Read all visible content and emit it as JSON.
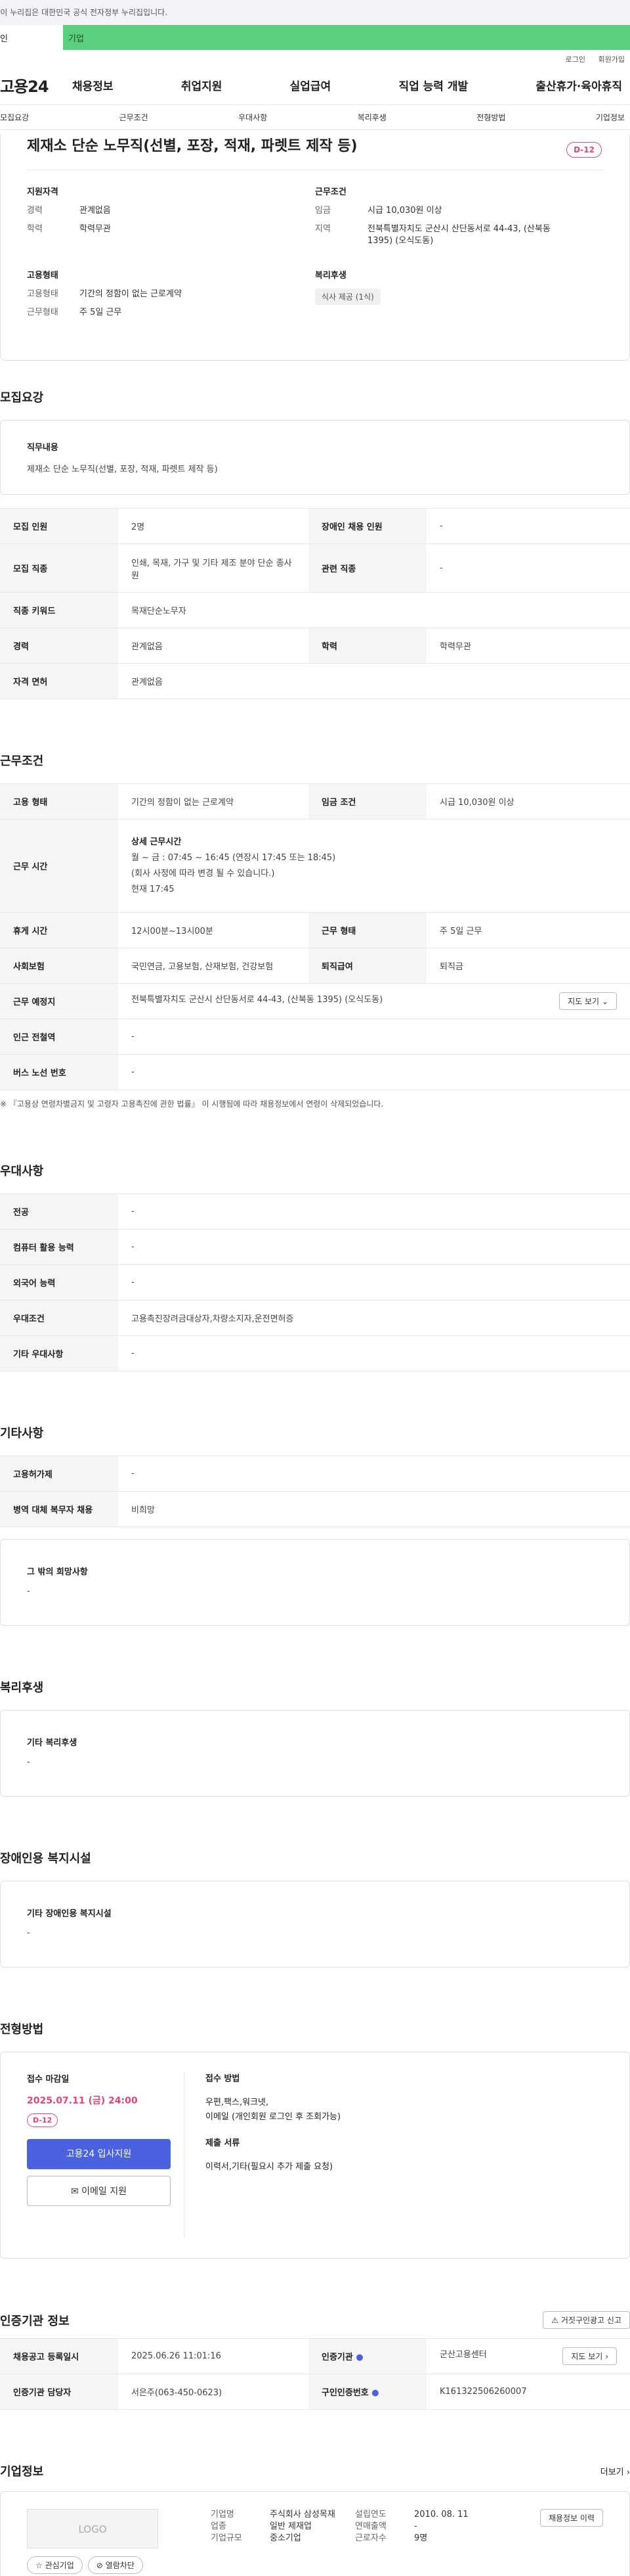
{
  "govbar": {
    "text": "○ 이 누리집은 대한민국 공식 전자정부 누리집입니다."
  },
  "top_tabs": {
    "left": "인",
    "right": "기업"
  },
  "util": {
    "login": "로그인",
    "join": "회원가입"
  },
  "gnb": {
    "logo": "고용24",
    "menu": [
      "채용정보",
      "취업지원",
      "실업급여",
      "직업 능력 개발",
      "출산휴가·육아휴직"
    ]
  },
  "subnav": [
    "모집요강",
    "근무조건",
    "우대사항",
    "복리후생",
    "전형방법",
    "기업정보"
  ],
  "header": {
    "title": "제재소 단순 노무직(선별, 포장, 적재, 파렛트 제작 등)",
    "dday": "D-12",
    "qual_title": "지원자격",
    "qual": [
      {
        "k": "경력",
        "v": "관계없음"
      },
      {
        "k": "학력",
        "v": "학력무관"
      }
    ],
    "cond_title": "근무조건",
    "cond": [
      {
        "k": "임금",
        "v": "시급 10,030원 이상"
      },
      {
        "k": "지역",
        "v": "전북특별자치도 군산시 산단동서로 44-43, (산북동 1395) (오식도동)"
      }
    ],
    "emp_title": "고용형태",
    "emp": [
      {
        "k": "고용형태",
        "v": "기간의 정함이 없는 근로계약"
      },
      {
        "k": "근무형태",
        "v": "주 5일 근무"
      }
    ],
    "welfare_title": "복리후생",
    "welfare_chip": "식사 제공 (1식)"
  },
  "recruit": {
    "title": "모집요강",
    "duty_label": "직무내용",
    "duty": "제재소 단순 노무직(선별, 포장, 적재, 파렛트 제작 등)",
    "rows": [
      {
        "k1": "모집 인원",
        "v1": "2명",
        "k2": "장애인 채용 인원",
        "v2": "-"
      },
      {
        "k1": "모집 직종",
        "v1": "인쇄, 목재, 가구 및 기타 제조 분야 단순 종사원",
        "k2": "관련 직종",
        "v2": "-"
      },
      {
        "k1": "직종 키워드",
        "v1": "목재단순노무자"
      },
      {
        "k1": "경력",
        "v1": "관계없음",
        "k2": "학력",
        "v2": "학력무관"
      },
      {
        "k1": "자격 면허",
        "v1": "관계없음"
      }
    ]
  },
  "work": {
    "title": "근무조건",
    "type_k": "고용 형태",
    "type_v": "기간의 정함이 없는 근로계약",
    "wage_k": "임금 조건",
    "wage_v": "시급 10,030원 이상",
    "hours_k": "근무 시간",
    "hours_title": "상세 근무시간",
    "hours_lines": [
      "월 ~ 금 : 07:45 ~ 16:45 (연장시 17:45 또는 18:45)",
      "(회사 사정에 따라 변경 될 수 있습니다.)",
      "현재 17:45"
    ],
    "break_k": "휴게 시간",
    "break_v": "12시00분~13시00분",
    "form_k": "근무 형태",
    "form_v": "주 5일 근무",
    "ins_k": "사회보험",
    "ins_v": "국민연금, 고용보험, 산재보험, 건강보험",
    "sev_k": "퇴직급여",
    "sev_v": "퇴직금",
    "place_k": "근무 예정지",
    "place_v": "전북특별자치도 군산시 산단동서로 44-43, (산북동 1395) (오식도동)",
    "map_btn": "지도 보기",
    "station_k": "인근 전철역",
    "station_v": "-",
    "bus_k": "버스 노선 번호",
    "bus_v": "-",
    "note": "※ 『고용상 연령차별금지 및 고령자 고용촉진에 관한 법률』 이 시행됨에 따라 채용정보에서 연령이 삭제되었습니다."
  },
  "pref": {
    "title": "우대사항",
    "rows": [
      {
        "k": "전공",
        "v": "-"
      },
      {
        "k": "컴퓨터 활용 능력",
        "v": "-"
      },
      {
        "k": "외국어 능력",
        "v": "-"
      },
      {
        "k": "우대조건",
        "v": "고용촉진장려금대상자,차량소지자,운전면허증"
      },
      {
        "k": "기타 우대사항",
        "v": "-"
      }
    ]
  },
  "etc": {
    "title": "기타사항",
    "rows": [
      {
        "k": "고용허가제",
        "v": "-"
      },
      {
        "k": "병역 대체 복무자 채용",
        "v": "비희망"
      }
    ],
    "hope_label": "그 밖의 희망사항",
    "hope_v": "-"
  },
  "welfare": {
    "title": "복리후생",
    "label": "기타 복리후생",
    "v": "-"
  },
  "disabled": {
    "title": "장애인용 복지시설",
    "label": "기타 장애인용 복지시설",
    "v": "-"
  },
  "selection": {
    "title": "전형방법",
    "deadline_label": "접수 마감일",
    "deadline": "2025.07.11 (금) 24:00",
    "dday": "D-12",
    "apply_btn": "고용24 입사지원",
    "email_btn": "이메일 지원",
    "method_label": "접수 방법",
    "method_lines": [
      "우편,팩스,워크넷,",
      "이메일 (개인회원 로그인 후 조회가능)"
    ],
    "docs_label": "제출 서류",
    "docs": "이력서,기타(필요시 추가 제출 요청)"
  },
  "cert": {
    "title": "인증기관 정보",
    "report_btn": "거짓구인광고 신고",
    "date_k": "채용공고 등록일시",
    "date_v": "2025.06.26 11:01:16",
    "org_k": "인증기관",
    "org_v": "군산고용센터",
    "map_btn": "지도 보기",
    "mgr_k": "인증기관 담당자",
    "mgr_v": "서은주(063-450-0623)",
    "num_k": "구인인증번호",
    "num_v": "K161322506260007"
  },
  "company": {
    "title": "기업정보",
    "more": "더보기",
    "logo": "LOGO",
    "fav_btn": "관심기업",
    "block_btn": "열람차단",
    "name_k": "기업명",
    "name_v": "주식회사 삼성목재",
    "ind_k": "업종",
    "ind_v": "일반 제재업",
    "size_k": "기업규모",
    "size_v": "중소기업",
    "est_k": "설립연도",
    "est_v": "2010. 08. 11",
    "sales_k": "연매출액",
    "sales_v": "-",
    "emp_k": "근로자수",
    "emp_v": "9명",
    "jobs_btn": "채용정보 이력"
  }
}
